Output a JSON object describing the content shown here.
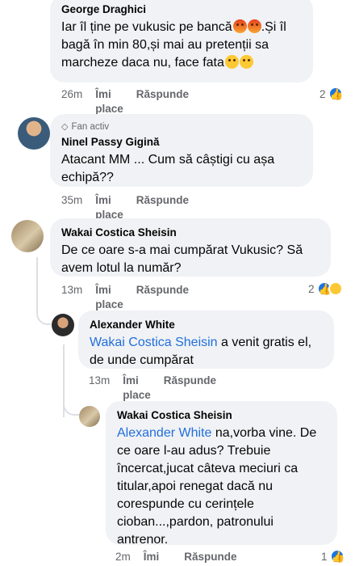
{
  "comments": [
    {
      "author": "George Draghici",
      "text_parts": [
        "Iar îl ține pe vukusic pe bancă",
        "",
        ".Și îl bagă în min 80,și mai au pretenții sa marcheze daca nu,  face fata",
        ""
      ],
      "time": "26m",
      "like_label": "Îmi place",
      "reply_label": "Răspunde",
      "reaction_count": "2"
    },
    {
      "author": "Ninel Passy Gigină",
      "badge": "Fan activ",
      "text": "Atacant MM ... Cum să câștigi cu așa echipă??",
      "time": "35m",
      "like_label": "Îmi place",
      "reply_label": "Răspunde"
    },
    {
      "author": "Wakai Costica Sheisin",
      "text": "De ce oare s-a mai cumpărat Vukusic? Să avem lotul la număr?",
      "time": "13m",
      "like_label": "Îmi place",
      "reply_label": "Răspunde",
      "reaction_count": "2"
    },
    {
      "author": "Alexander White",
      "mention": "Wakai Costica Sheisin",
      "text": " a venit gratis el, de unde cumpărat",
      "time": "13m",
      "like_label": "Îmi place",
      "reply_label": "Răspunde"
    },
    {
      "author": "Wakai Costica Sheisin",
      "mention": "Alexander White",
      "text": " na,vorba vine. De ce oare l-au adus? Trebuie încercat,jucat câteva meciuri ca titular,apoi renegat dacă nu corespunde cu cerințele cioban...,pardon, patronului antrenor.",
      "time": "2m",
      "like_label": "Îmi place",
      "reply_label": "Răspunde",
      "reaction_count": "1"
    }
  ],
  "colors": {
    "bubble": "#f0f2f5",
    "mention": "#216fdb",
    "meta": "#65676b",
    "like": "#1b74e4",
    "haha": "#fcc934"
  }
}
